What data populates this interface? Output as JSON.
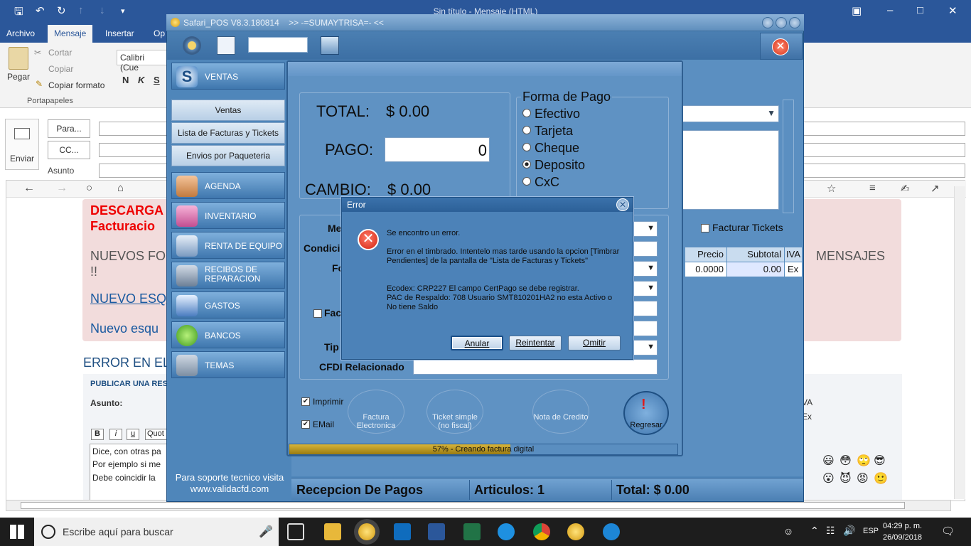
{
  "outlook": {
    "title": "Sin título - Mensaje (HTML)",
    "tabs": [
      "Archivo",
      "Mensaje",
      "Insertar",
      "Op"
    ],
    "clipboard": {
      "paste": "Pegar",
      "cut": "Cortar",
      "copy": "Copiar",
      "format": "Copiar formato",
      "group": "Portapapeles"
    },
    "font_name": "Calibri (Cue",
    "format_buttons": [
      "N",
      "K",
      "S"
    ],
    "compose": {
      "send": "Enviar",
      "to": "Para...",
      "cc": "CC...",
      "subject": "Asunto"
    }
  },
  "page": {
    "banner_lines": [
      "DESCARGA",
      "Facturacio",
      "NUEVOS FO",
      "!!",
      "NUEVO ESQ",
      "Nuevo esqu"
    ],
    "banner_right": "MENSAJES",
    "error_heading": "ERROR EN EL",
    "reply_title": "PUBLICAR UNA RES",
    "subject_label": "Asunto:",
    "editor_buttons": [
      "B",
      "i",
      "u",
      "Quot"
    ],
    "body_lines": [
      "Dice, con otras pa",
      "Por ejemplo si me",
      "Debe coincidir la"
    ],
    "iva_labels": [
      "VA",
      "Ex"
    ]
  },
  "pos": {
    "title": "Safari_POS V8.3.180814",
    "subtitle": ">> -=SUMAYTRISA=- <<",
    "sidebar": {
      "ventas": "VENTAS",
      "sub": [
        "Ventas",
        "Lista de Facturas y Tickets",
        "Envios por Paqueteria"
      ],
      "items": [
        "AGENDA",
        "INVENTARIO",
        "RENTA DE EQUIPO",
        "RECIBOS DE REPARACION",
        "GASTOS",
        "BANCOS",
        "TEMAS"
      ],
      "support": "Para soporte tecnico visita www.validacfd.com"
    },
    "payment": {
      "total_label": "TOTAL:",
      "total_value": "$ 0.00",
      "pago_label": "PAGO:",
      "pago_value": "0",
      "cambio_label": "CAMBIO:",
      "cambio_value": "$ 0.00",
      "forma_title": "Forma de Pago",
      "forma_options": [
        "Efectivo",
        "Tarjeta",
        "Cheque",
        "Deposito",
        "CxC"
      ],
      "forma_selected": "Deposito",
      "fields": [
        "Me",
        "Condici",
        "Fo",
        "Fac",
        "Tip"
      ],
      "cfdi_label": "CFDI Relacionado",
      "facturar_tickets": "Facturar Tickets",
      "imprimir": "Imprimir",
      "email": "EMail",
      "buttons": [
        "Factura Electronica",
        "Ticket simple (no fiscal)",
        "Nota de Credito",
        "Regresar"
      ],
      "progress_text": "57% - Creando factura digital",
      "progress": 57
    },
    "grid": {
      "headers": [
        "Precio",
        "Subtotal",
        "IVA"
      ],
      "row": [
        "0.0000",
        "0.00",
        "Ex"
      ]
    },
    "statusbar": {
      "left": "Recepcion De Pagos",
      "mid": "Articulos: 1",
      "right": "Total: $ 0.00"
    }
  },
  "error_dialog": {
    "title": "Error",
    "line1": "Se encontro un error.",
    "line2": "Error en el timbrado. Intentelo mas tarde usando la opcion [Timbrar Pendientes] de la pantalla de \"Lista de Facturas y Tickets\"",
    "line3": "Ecodex: CRP227 El campo CertPago se debe registrar.",
    "line4": "PAC de Respaldo: 708  Usuario SMT810201HA2 no esta Activo o No tiene Saldo",
    "buttons": [
      "Anular",
      "Reintentar",
      "Omitir"
    ]
  },
  "taskbar": {
    "search": "Escribe aquí para buscar",
    "lang": "ESP",
    "time": "04:29 p. m.",
    "date": "26/09/2018"
  },
  "colors": {
    "outlook": "#2b579a",
    "pos": "#4f86ba",
    "error": "#d2220e"
  }
}
